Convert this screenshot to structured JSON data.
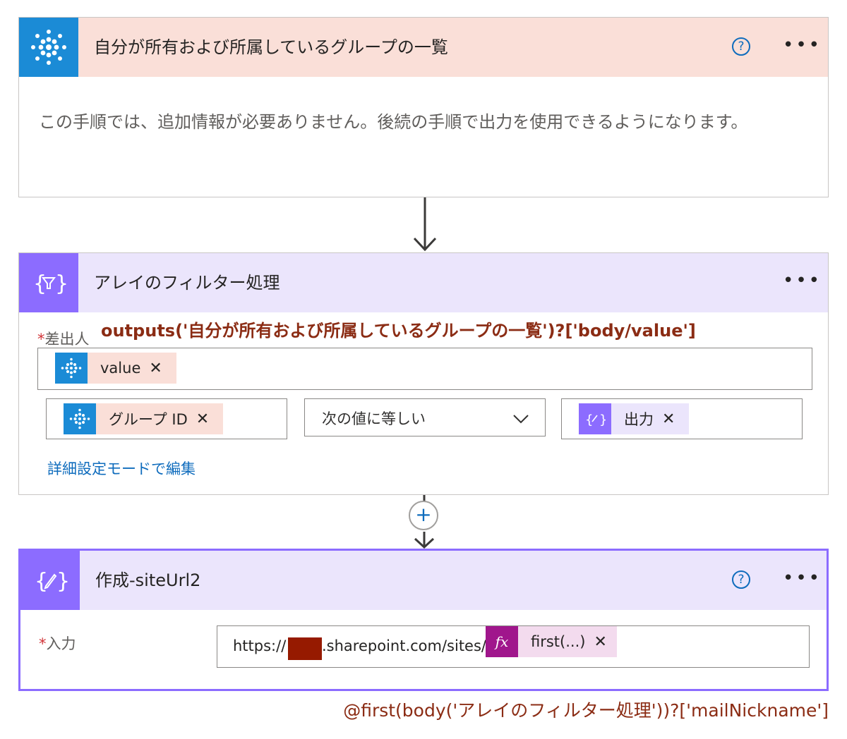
{
  "step1": {
    "title": "自分が所有および所属しているグループの一覧",
    "help_label": "?",
    "more_label": "•••",
    "message": "この手順では、追加情報が必要ありません。後続の手順で出力を使用できるようになります。"
  },
  "step2": {
    "title": "アレイのフィルター処理",
    "more_label": "•••",
    "from_label": "差出人",
    "required_mark": "*",
    "from_token": "value",
    "left_token": "グループ ID",
    "operator": "次の値に等しい",
    "right_token": "出力",
    "advanced_link": "詳細設定モードで編集",
    "annotation": "outputs('自分が所有および所属しているグループの一覧')?['body/value']"
  },
  "add_button": "+",
  "step3": {
    "title": "作成-siteUrl2",
    "help_label": "?",
    "more_label": "•••",
    "input_label": "入力",
    "required_mark": "*",
    "url_prefix": "https://",
    "url_suffix": ".sharepoint.com/sites/",
    "fx_label": "fx",
    "fx_token": "first(...)",
    "annotation": "@first(body('アレイのフィルター処理'))?['mailNickname']"
  },
  "remove_label": "✕",
  "colors": {
    "office365_header": "#fadfd8",
    "office365_icon": "#1b8bd6",
    "data_ops_header": "#ebe5fc",
    "data_ops_icon": "#8c6cff",
    "selected_border": "#8c6cff",
    "annotation_text": "#8b2c14",
    "redaction": "#961a00",
    "expression_icon": "#a0168c",
    "expression_token_bg": "#f3dbee",
    "link": "#0f6cbd"
  },
  "icons": [
    "office365-dots-icon",
    "filter-braces-icon",
    "compose-braces-icon",
    "help-icon",
    "more-icon",
    "remove-icon",
    "chevron-down-icon",
    "plus-icon",
    "arrow-down-icon"
  ]
}
